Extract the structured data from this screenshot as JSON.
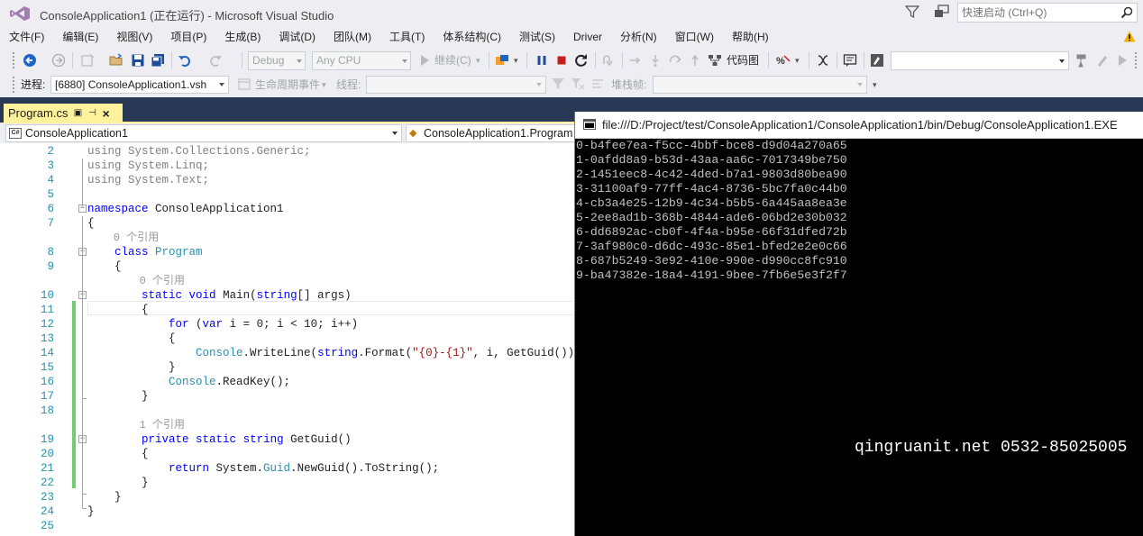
{
  "window": {
    "title": "ConsoleApplication1 (正在运行) - Microsoft Visual Studio",
    "quick_launch_placeholder": "快速启动 (Ctrl+Q)"
  },
  "menu": [
    "文件(F)",
    "编辑(E)",
    "视图(V)",
    "项目(P)",
    "生成(B)",
    "调试(D)",
    "团队(M)",
    "工具(T)",
    "体系结构(C)",
    "测试(S)",
    "Driver",
    "分析(N)",
    "窗口(W)",
    "帮助(H)"
  ],
  "toolbar": {
    "config": "Debug",
    "platform": "Any CPU",
    "continue_label": "继续(C)",
    "code_map_label": "代码图"
  },
  "debug_location": {
    "process_label": "进程:",
    "process_value": "[6880] ConsoleApplication1.vsh",
    "lifecycle_label": "生命周期事件",
    "thread_label": "线程:",
    "stackframe_label": "堆栈帧:"
  },
  "editor": {
    "tab_name": "Program.cs",
    "nav_project": "ConsoleApplication1",
    "nav_type": "ConsoleApplication1.Program",
    "lines": [
      {
        "no": "2",
        "segs": [
          {
            "t": "using",
            "c": "gray"
          },
          {
            "t": " System.Collections.Generic;",
            "c": "gray"
          }
        ]
      },
      {
        "no": "3",
        "segs": [
          {
            "t": "using",
            "c": "gray"
          },
          {
            "t": " System.Linq;",
            "c": "gray"
          }
        ]
      },
      {
        "no": "4",
        "segs": [
          {
            "t": "using",
            "c": "gray"
          },
          {
            "t": " System.Text;",
            "c": "gray"
          }
        ]
      },
      {
        "no": "5",
        "segs": []
      },
      {
        "no": "6",
        "segs": [
          {
            "t": "namespace",
            "c": "kw"
          },
          {
            "t": " ConsoleApplication1",
            "c": ""
          }
        ]
      },
      {
        "no": "7",
        "segs": [
          {
            "t": "{",
            "c": ""
          }
        ]
      },
      {
        "lens": "0 个引用",
        "indent": "    "
      },
      {
        "no": "8",
        "segs": [
          {
            "t": "    ",
            "c": ""
          },
          {
            "t": "class",
            "c": "kw"
          },
          {
            "t": " ",
            "c": ""
          },
          {
            "t": "Program",
            "c": "ty"
          }
        ]
      },
      {
        "no": "9",
        "segs": [
          {
            "t": "    {",
            "c": ""
          }
        ]
      },
      {
        "lens": "0 个引用",
        "indent": "        "
      },
      {
        "no": "10",
        "segs": [
          {
            "t": "        ",
            "c": ""
          },
          {
            "t": "static",
            "c": "kw"
          },
          {
            "t": " ",
            "c": ""
          },
          {
            "t": "void",
            "c": "kw"
          },
          {
            "t": " Main(",
            "c": ""
          },
          {
            "t": "string",
            "c": "kw"
          },
          {
            "t": "[] args)",
            "c": ""
          }
        ]
      },
      {
        "no": "11",
        "segs": [
          {
            "t": "        {",
            "c": ""
          }
        ]
      },
      {
        "no": "12",
        "segs": [
          {
            "t": "            ",
            "c": ""
          },
          {
            "t": "for",
            "c": "kw"
          },
          {
            "t": " (",
            "c": ""
          },
          {
            "t": "var",
            "c": "kw"
          },
          {
            "t": " i = 0; i < 10; i++)",
            "c": ""
          }
        ]
      },
      {
        "no": "13",
        "segs": [
          {
            "t": "            {",
            "c": ""
          }
        ]
      },
      {
        "no": "14",
        "segs": [
          {
            "t": "                ",
            "c": ""
          },
          {
            "t": "Console",
            "c": "ty"
          },
          {
            "t": ".WriteLine(",
            "c": ""
          },
          {
            "t": "string",
            "c": "kw"
          },
          {
            "t": ".Format(",
            "c": ""
          },
          {
            "t": "\"{0}-{1}\"",
            "c": "str"
          },
          {
            "t": ", i, GetGuid()));",
            "c": ""
          }
        ]
      },
      {
        "no": "15",
        "segs": [
          {
            "t": "            }",
            "c": ""
          }
        ]
      },
      {
        "no": "16",
        "segs": [
          {
            "t": "            ",
            "c": ""
          },
          {
            "t": "Console",
            "c": "ty"
          },
          {
            "t": ".ReadKey();",
            "c": ""
          }
        ]
      },
      {
        "no": "17",
        "segs": [
          {
            "t": "        }",
            "c": ""
          }
        ]
      },
      {
        "no": "18",
        "segs": []
      },
      {
        "lens": "1 个引用",
        "indent": "        "
      },
      {
        "no": "19",
        "segs": [
          {
            "t": "        ",
            "c": ""
          },
          {
            "t": "private",
            "c": "kw"
          },
          {
            "t": " ",
            "c": ""
          },
          {
            "t": "static",
            "c": "kw"
          },
          {
            "t": " ",
            "c": ""
          },
          {
            "t": "string",
            "c": "kw"
          },
          {
            "t": " GetGuid()",
            "c": ""
          }
        ]
      },
      {
        "no": "20",
        "segs": [
          {
            "t": "        {",
            "c": ""
          }
        ]
      },
      {
        "no": "21",
        "segs": [
          {
            "t": "            ",
            "c": ""
          },
          {
            "t": "return",
            "c": "kw"
          },
          {
            "t": " System.",
            "c": ""
          },
          {
            "t": "Guid",
            "c": "ty"
          },
          {
            "t": ".NewGuid().ToString();",
            "c": ""
          }
        ]
      },
      {
        "no": "22",
        "segs": [
          {
            "t": "        }",
            "c": ""
          }
        ]
      },
      {
        "no": "23",
        "segs": [
          {
            "t": "    }",
            "c": ""
          }
        ]
      },
      {
        "no": "24",
        "segs": [
          {
            "t": "}",
            "c": ""
          }
        ]
      },
      {
        "no": "25",
        "segs": []
      }
    ]
  },
  "console": {
    "title": "file:///D:/Project/test/ConsoleApplication1/ConsoleApplication1/bin/Debug/ConsoleApplication1.EXE",
    "lines": [
      "0-b4fee7ea-f5cc-4bbf-bce8-d9d04a270a65",
      "1-0afdd8a9-b53d-43aa-aa6c-7017349be750",
      "2-1451eec8-4c42-4ded-b7a1-9803d80bea90",
      "3-31100af9-77ff-4ac4-8736-5bc7fa0c44b0",
      "4-cb3a4e25-12b9-4c34-b5b5-6a445aa8ea3e",
      "5-2ee8ad1b-368b-4844-ade6-06bd2e30b032",
      "6-dd6892ac-cb0f-4f4a-b95e-66f31dfed72b",
      "7-3af980c0-d6dc-493c-85e1-bfed2e2e0c66",
      "8-687b5249-3e92-410e-990e-d990cc8fc910",
      "9-ba47382e-18a4-4191-9bee-7fb6e5e3f2f7"
    ]
  },
  "watermark": "qingruanit.net 0532-85025005",
  "colors": {
    "keyword": "#0000ff",
    "type": "#2b91af",
    "string": "#a31515",
    "tab_active": "#fff29d",
    "dark_band": "#293955",
    "change_bar": "#6fcf6f"
  }
}
